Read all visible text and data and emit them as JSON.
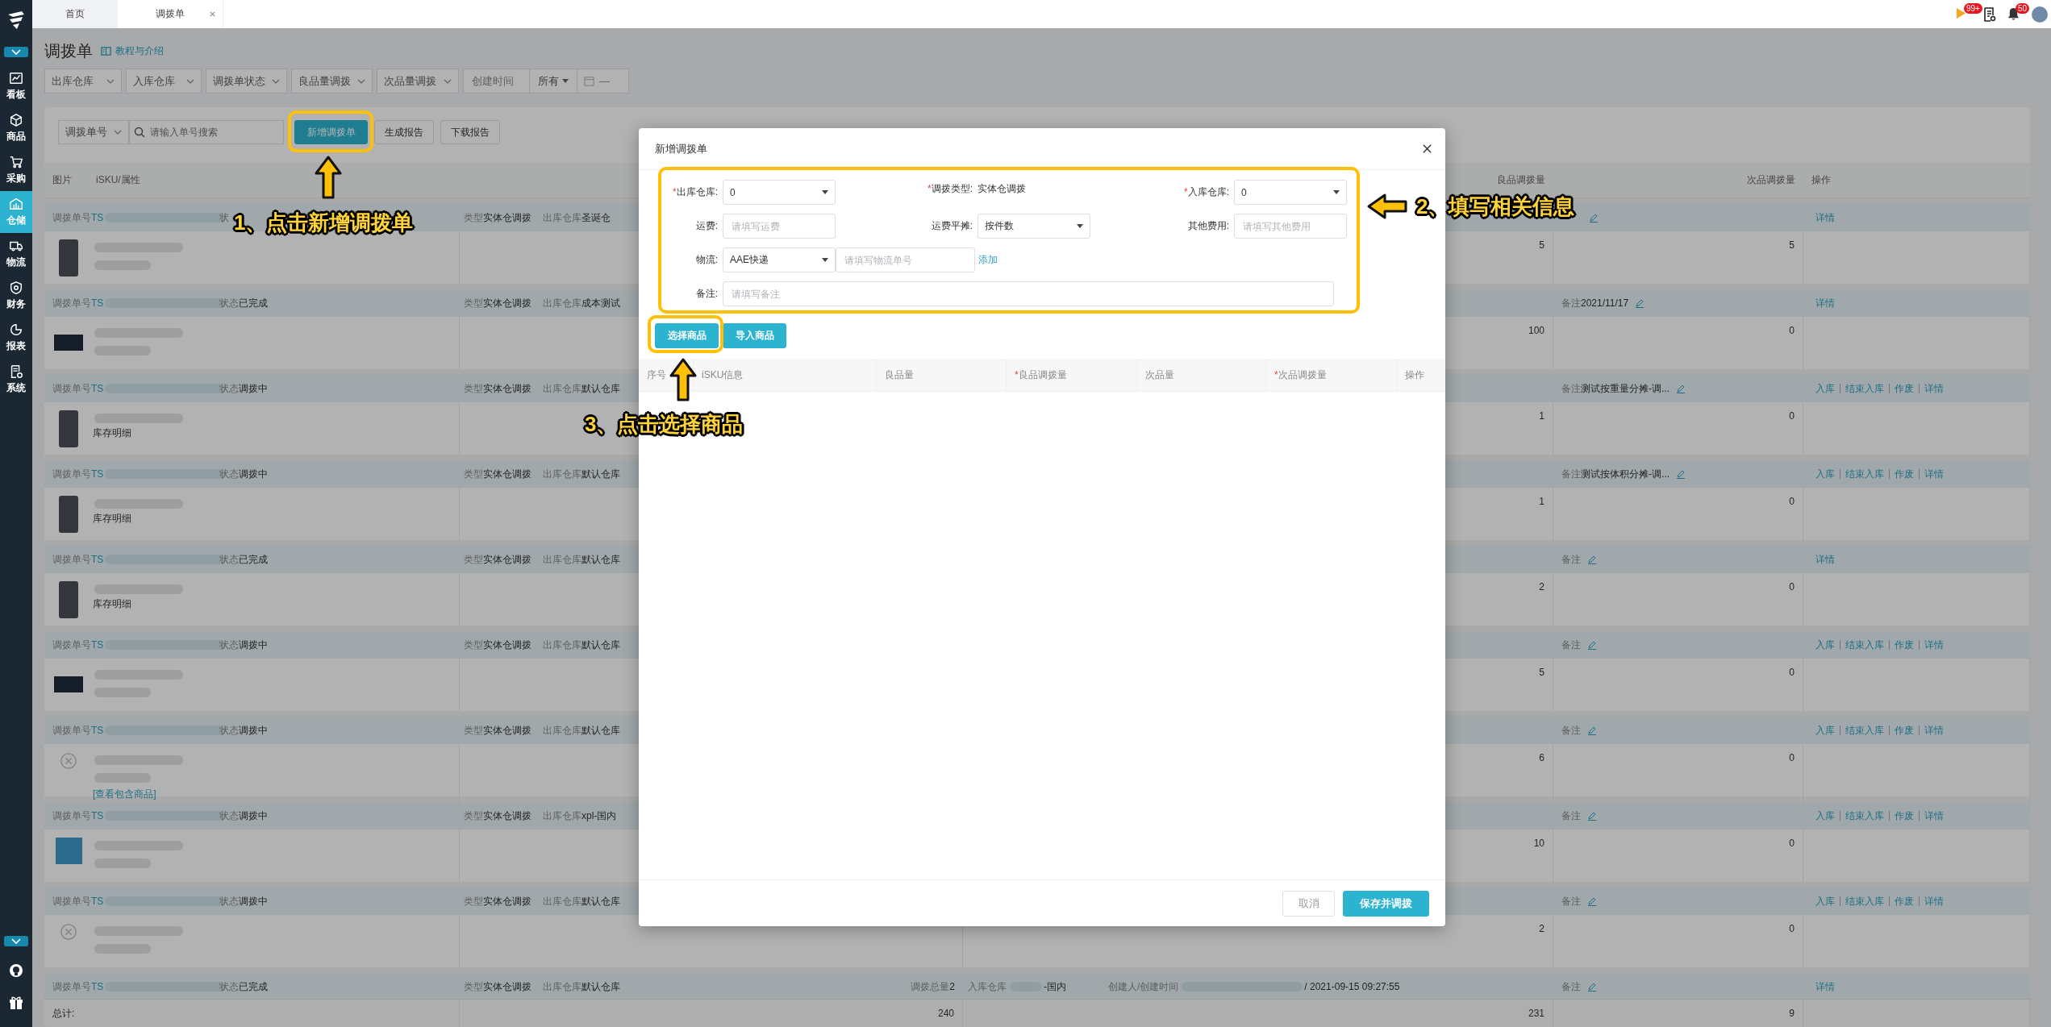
{
  "sidebar": {
    "items": [
      {
        "label": "看板",
        "kind": "dashboard",
        "selected": false
      },
      {
        "label": "商品",
        "kind": "box",
        "selected": false
      },
      {
        "label": "采购",
        "kind": "cart",
        "selected": false
      },
      {
        "label": "仓储",
        "kind": "warehouse",
        "selected": true
      },
      {
        "label": "物流",
        "kind": "truck",
        "selected": false
      },
      {
        "label": "财务",
        "kind": "finance",
        "selected": false
      },
      {
        "label": "报表",
        "kind": "report",
        "selected": false
      },
      {
        "label": "系统",
        "kind": "system",
        "selected": false
      }
    ]
  },
  "tabs": [
    {
      "label": "首页",
      "selected": false,
      "closable": false
    },
    {
      "label": "调拨单",
      "selected": true,
      "closable": true
    }
  ],
  "toolbar": {
    "flag_badge": "99+",
    "bell_badge": "50"
  },
  "page": {
    "title": "调拨单",
    "help_link": "教程与介绍"
  },
  "filters": [
    {
      "label": "出库仓库"
    },
    {
      "label": "入库仓库"
    },
    {
      "label": "调拨单状态"
    },
    {
      "label": "良品量调拨"
    },
    {
      "label": "次品量调拨"
    }
  ],
  "date_filter": {
    "label": "创建时间",
    "range": "所有",
    "separator": "—"
  },
  "search": {
    "field": "调拨单号",
    "placeholder": "请输入单号搜索"
  },
  "buttons": [
    {
      "label": "新增调拨单",
      "primary": true
    },
    {
      "label": "生成报告",
      "primary": false
    },
    {
      "label": "下载报告",
      "primary": false
    }
  ],
  "table": {
    "columns": {
      "image": "图片",
      "sku": "iSKU/属性",
      "good_qty": "良品调拨量",
      "defect_qty": "次品调拨量",
      "actions": "操作"
    },
    "rows": [
      {
        "order_label": "调拨单号",
        "order_no": "TS",
        "status_label": "状",
        "type_label": "类型",
        "type": "实体仓调拨",
        "from_label": "出库仓库",
        "from": "圣诞仓",
        "actions": [
          "详情"
        ],
        "kind": "portrait",
        "good": "5",
        "defect": "5"
      },
      {
        "order_label": "调拨单号",
        "order_no": "TS",
        "status_label": "状态",
        "status": "已完成",
        "type_label": "类型",
        "type": "实体仓调拨",
        "from_label": "出库仓库",
        "from": "成本测试",
        "remark_label": "备注",
        "remark": "2021/11/17",
        "actions": [
          "详情"
        ],
        "kind": "landscape",
        "good": "100",
        "defect": "0"
      },
      {
        "order_label": "调拨单号",
        "order_no": "TS",
        "status_label": "状态",
        "status": "调拨中",
        "type_label": "类型",
        "type": "实体仓调拨",
        "from_label": "出库仓库",
        "from": "默认仓库",
        "remark_label": "备注",
        "remark": "测试按重量分摊-调...",
        "actions": [
          "入库",
          "结束入库",
          "作废",
          "详情"
        ],
        "kind": "portrait",
        "sku_note": "库存明细",
        "good": "1",
        "defect": "0"
      },
      {
        "order_label": "调拨单号",
        "order_no": "TS",
        "status_label": "状态",
        "status": "调拨中",
        "type_label": "类型",
        "type": "实体仓调拨",
        "from_label": "出库仓库",
        "from": "默认仓库",
        "remark_label": "备注",
        "remark": "测试按体积分摊-调...",
        "actions": [
          "入库",
          "结束入库",
          "作废",
          "详情"
        ],
        "kind": "portrait",
        "sku_note": "库存明细",
        "good": "1",
        "defect": "0"
      },
      {
        "order_label": "调拨单号",
        "order_no": "TS",
        "status_label": "状态",
        "status": "已完成",
        "type_label": "类型",
        "type": "实体仓调拨",
        "from_label": "出库仓库",
        "from": "默认仓库",
        "remark_label": "备注",
        "actions": [
          "详情"
        ],
        "kind": "portrait",
        "sku_note": "库存明细",
        "good": "2",
        "defect": "0"
      },
      {
        "order_label": "调拨单号",
        "order_no": "TS",
        "status_label": "状态",
        "status": "调拨中",
        "type_label": "类型",
        "type": "实体仓调拨",
        "from_label": "出库仓库",
        "from": "默认仓库",
        "remark_label": "备注",
        "actions": [
          "入库",
          "结束入库",
          "作废",
          "详情"
        ],
        "kind": "landscape",
        "good": "5",
        "defect": "0"
      },
      {
        "order_label": "调拨单号",
        "order_no": "TS",
        "status_label": "状态",
        "status": "调拨中",
        "type_label": "类型",
        "type": "实体仓调拨",
        "from_label": "出库仓库",
        "from": "默认仓库",
        "remark_label": "备注",
        "actions": [
          "入库",
          "结束入库",
          "作废",
          "详情"
        ],
        "kind": "none",
        "contents_link": "[查看包含商品]",
        "good": "6",
        "defect": "0"
      },
      {
        "order_label": "调拨单号",
        "order_no": "TS",
        "status_label": "状态",
        "status": "调拨中",
        "type_label": "类型",
        "type": "实体仓调拨",
        "from_label": "出库仓库",
        "from": "xpl-国内",
        "remark_label": "备注",
        "actions": [
          "入库",
          "结束入库",
          "作废",
          "详情"
        ],
        "kind": "square",
        "good": "10",
        "defect": "0"
      },
      {
        "order_label": "调拨单号",
        "order_no": "TS",
        "status_label": "状态",
        "status": "调拨中",
        "type_label": "类型",
        "type": "实体仓调拨",
        "from_label": "出库仓库",
        "from": "默认仓库",
        "remark_label": "备注",
        "actions": [
          "入库",
          "结束入库",
          "作废",
          "详情"
        ],
        "kind": "none",
        "good": "2",
        "defect": "0"
      },
      {
        "order_label": "调拨单号",
        "order_no": "TS",
        "status_label": "状态",
        "status": "已完成",
        "type_label": "类型",
        "type": "实体仓调拨",
        "from_label": "出库仓库",
        "from": "默认仓库",
        "total_label": "调拨总量",
        "total": "2",
        "to_label": "入库仓库",
        "to": "-国内",
        "creator_label": "创建人/创建时间",
        "created": "/ 2021-09-15 09:27:55",
        "remark_label": "备注",
        "actions": [
          "详情"
        ]
      }
    ],
    "total_row": {
      "label": "总计:",
      "sum": "240",
      "good": "231",
      "defect": "9"
    }
  },
  "modal": {
    "title": "新增调拨单",
    "fields": [
      {
        "required_mark": "*",
        "label": "出库仓库:",
        "kind": "select",
        "value": "0"
      },
      {
        "required_mark": "*",
        "label": "调拨类型:",
        "kind": "static",
        "value": "实体仓调拨"
      },
      {
        "required_mark": "*",
        "label": "入库仓库:",
        "kind": "select",
        "value": "0"
      },
      {
        "label": "运费:",
        "kind": "input",
        "placeholder": "请填写运费"
      },
      {
        "label": "运费平摊:",
        "kind": "select",
        "value": "按件数"
      },
      {
        "label": "其他费用:",
        "kind": "input",
        "placeholder": "请填写其他费用"
      },
      {
        "label": "物流:",
        "kind": "carrier",
        "value": "AAE快递",
        "placeholder": "请填写物流单号",
        "link": "添加"
      },
      {
        "label": "备注:",
        "kind": "wide",
        "placeholder": "请填写备注"
      }
    ],
    "buttons": [
      {
        "label": "选择商品"
      },
      {
        "label": "导入商品"
      }
    ],
    "columns": [
      {
        "label": "序号"
      },
      {
        "label": "iSKU信息"
      },
      {
        "label": "良品量"
      },
      {
        "required_mark": "*",
        "label": "良品调拨量"
      },
      {
        "label": "次品量"
      },
      {
        "required_mark": "*",
        "label": "次品调拨量"
      },
      {
        "label": "操作"
      }
    ],
    "footer": [
      {
        "label": "取消",
        "primary": false
      },
      {
        "label": "保存并调拨",
        "primary": true
      }
    ]
  },
  "annotations": [
    {
      "text": "1、点击新增调拨单",
      "kind": "up"
    },
    {
      "text": "2、填写相关信息",
      "kind": "left"
    },
    {
      "text": "3、点击选择商品",
      "kind": "up"
    }
  ]
}
